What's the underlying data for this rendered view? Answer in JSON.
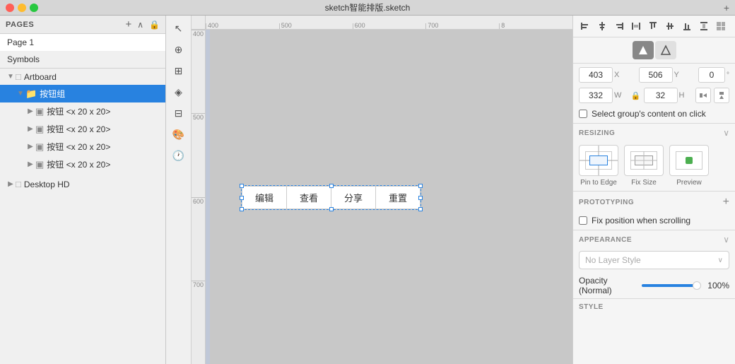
{
  "titlebar": {
    "title": "sketch智能排版.sketch",
    "plus_label": "+"
  },
  "sidebar": {
    "header_title": "PAGES",
    "lock_icon": "🔒",
    "pages": [
      {
        "label": "Page 1",
        "active": true
      },
      {
        "label": "Symbols",
        "active": false
      }
    ],
    "layers": [
      {
        "label": "Artboard",
        "level": 0,
        "type": "artboard",
        "expanded": true
      },
      {
        "label": "按钮组",
        "level": 1,
        "type": "group",
        "expanded": true,
        "selected": true
      },
      {
        "label": "按钮 <x 20 x 20>",
        "level": 2,
        "type": "group"
      },
      {
        "label": "按钮 <x 20 x 20>",
        "level": 2,
        "type": "group"
      },
      {
        "label": "按钮 <x 20 x 20>",
        "level": 2,
        "type": "group"
      },
      {
        "label": "按钮 <x 20 x 20>",
        "level": 2,
        "type": "group"
      }
    ],
    "desktop_label": "Desktop HD"
  },
  "canvas": {
    "buttons": [
      {
        "label": "编辑"
      },
      {
        "label": "查看"
      },
      {
        "label": "分享"
      },
      {
        "label": "重置"
      }
    ],
    "ruler_marks": [
      "400",
      "500",
      "600",
      "700",
      "8"
    ]
  },
  "right_panel": {
    "toolbar": {
      "align_left": "⊢",
      "align_center": "⊣",
      "align_right": "⊤",
      "dist_h": "⊥",
      "align_top": "⊦",
      "align_mid": "⊧",
      "align_bot": "⊨",
      "dist_v": "⊩",
      "plus": "+"
    },
    "tabs": {
      "fill_icon": "◆",
      "border_icon": "◇"
    },
    "x": "403",
    "y": "506",
    "rotation": "0",
    "w": "332",
    "h": "32",
    "select_group_label": "Select group's content on click",
    "resizing": {
      "title": "RESIZING",
      "options": [
        {
          "label": "Pin to Edge"
        },
        {
          "label": "Fix Size"
        },
        {
          "label": "Preview"
        }
      ]
    },
    "prototyping": {
      "title": "PROTOTYPING",
      "fix_position_label": "Fix position when scrolling"
    },
    "appearance": {
      "title": "APPEARANCE",
      "style_placeholder": "No Layer Style"
    },
    "opacity": {
      "label": "Opacity (Normal)",
      "value": "100%"
    },
    "style_title": "STYLE"
  }
}
